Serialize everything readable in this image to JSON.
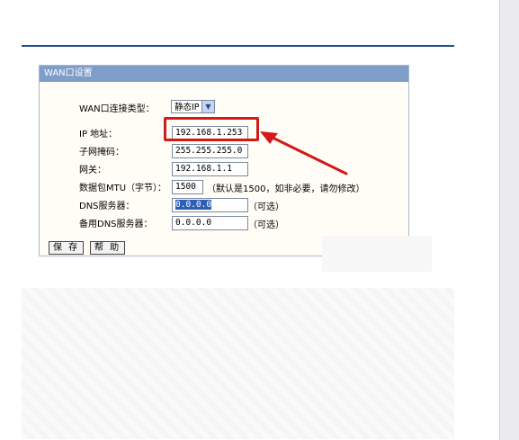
{
  "panel": {
    "title": "WAN口设置"
  },
  "fields": {
    "wan_type": {
      "label": "WAN口连接类型：",
      "value": "静态IP"
    },
    "ip": {
      "label": "IP 地址：",
      "value": "192.168.1.253"
    },
    "mask": {
      "label": "子网掩码：",
      "value": "255.255.255.0"
    },
    "gateway": {
      "label": "网关：",
      "value": "192.168.1.1"
    },
    "mtu": {
      "label": "数据包MTU（字节）：",
      "value": "1500",
      "hint": "（默认是1500，如非必要，请勿修改）"
    },
    "dns": {
      "label": "DNS服务器：",
      "value": "0.0.0.0",
      "hint": "（可选）"
    },
    "dns2": {
      "label": "备用DNS服务器：",
      "value": "0.0.0.0",
      "hint": "（可选）"
    }
  },
  "buttons": {
    "save": "保 存",
    "help": "帮 助"
  },
  "colors": {
    "title_bar": "#7f9dc9",
    "annotation": "#d21a1a",
    "rule": "#1f4f8c"
  }
}
